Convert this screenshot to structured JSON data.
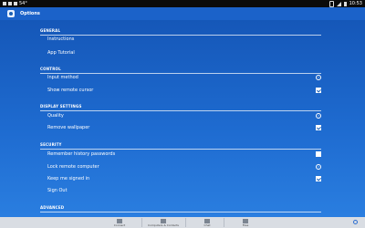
{
  "status_bar": {
    "temperature": "54°",
    "time": "10:53"
  },
  "header": {
    "title": "Options"
  },
  "sections": [
    {
      "title": "GENERAL",
      "items": [
        {
          "label": "Instructions",
          "control": "none"
        },
        {
          "label": "App Tutorial",
          "control": "none"
        }
      ]
    },
    {
      "title": "CONTROL",
      "items": [
        {
          "label": "Input method",
          "control": "chevron"
        },
        {
          "label": "Show remote cursor",
          "control": "checkbox",
          "checked": true
        }
      ]
    },
    {
      "title": "DISPLAY SETTINGS",
      "items": [
        {
          "label": "Quality",
          "control": "chevron"
        },
        {
          "label": "Remove wallpaper",
          "control": "checkbox",
          "checked": true
        }
      ]
    },
    {
      "title": "SECURITY",
      "items": [
        {
          "label": "Remember history passwords",
          "control": "checkbox",
          "checked": false
        },
        {
          "label": "Lock remote computer",
          "control": "chevron"
        },
        {
          "label": "Keep me signed in",
          "control": "checkbox",
          "checked": true
        },
        {
          "label": "Sign Out",
          "control": "none"
        }
      ]
    },
    {
      "title": "ADVANCED",
      "items": []
    }
  ],
  "bottom_nav": [
    {
      "label": "Connect",
      "icon": "connect-icon"
    },
    {
      "label": "Computers & Contacts",
      "icon": "contacts-icon"
    },
    {
      "label": "Chat",
      "icon": "chat-icon"
    },
    {
      "label": "Files",
      "icon": "files-icon"
    }
  ],
  "colors": {
    "background": "#1a5fb4",
    "bottom_bar": "#d9dde3",
    "accent": "#2e6fd1"
  }
}
